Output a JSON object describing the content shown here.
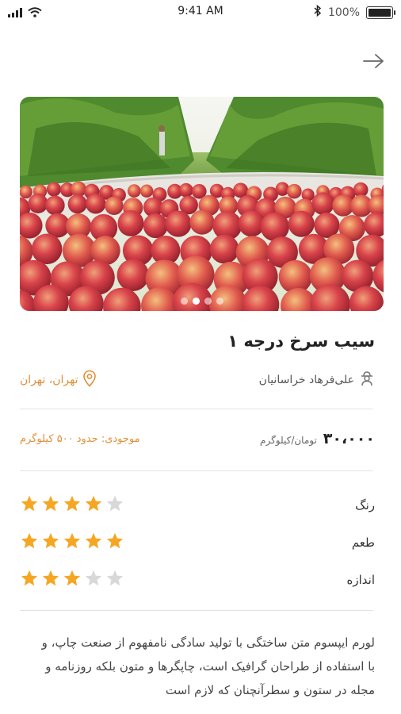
{
  "status_bar": {
    "time": "9:41 AM",
    "battery": "100%",
    "battery_level": 1.0
  },
  "hero": {
    "slide_count": 4,
    "active_slide": 1
  },
  "product": {
    "title": "سیب سرخ درجه ۱",
    "seller": "علی‌فرهاد خراسانیان",
    "location": "تهران، تهران",
    "price": "۳۰،۰۰۰",
    "price_unit": "تومان/کیلوگرم",
    "stock": "موجودی: حدود ۵۰۰ کیلوگرم"
  },
  "ratings": [
    {
      "label": "رنگ",
      "value": 4,
      "max": 5
    },
    {
      "label": "طعم",
      "value": 5,
      "max": 5
    },
    {
      "label": "اندازه",
      "value": 3,
      "max": 5
    }
  ],
  "description": "لورم ایپسوم متن ساختگی با تولید سادگی نامفهوم از صنعت چاپ، و با استفاده از طراحان گرافیک است، چاپگرها و متون بلکه روزنامه و مجله در ستون و سطرآنچنان که لازم است",
  "colors": {
    "accent": "#e0903a",
    "star_filled": "#f5a623",
    "star_empty": "#d8d8d8"
  }
}
